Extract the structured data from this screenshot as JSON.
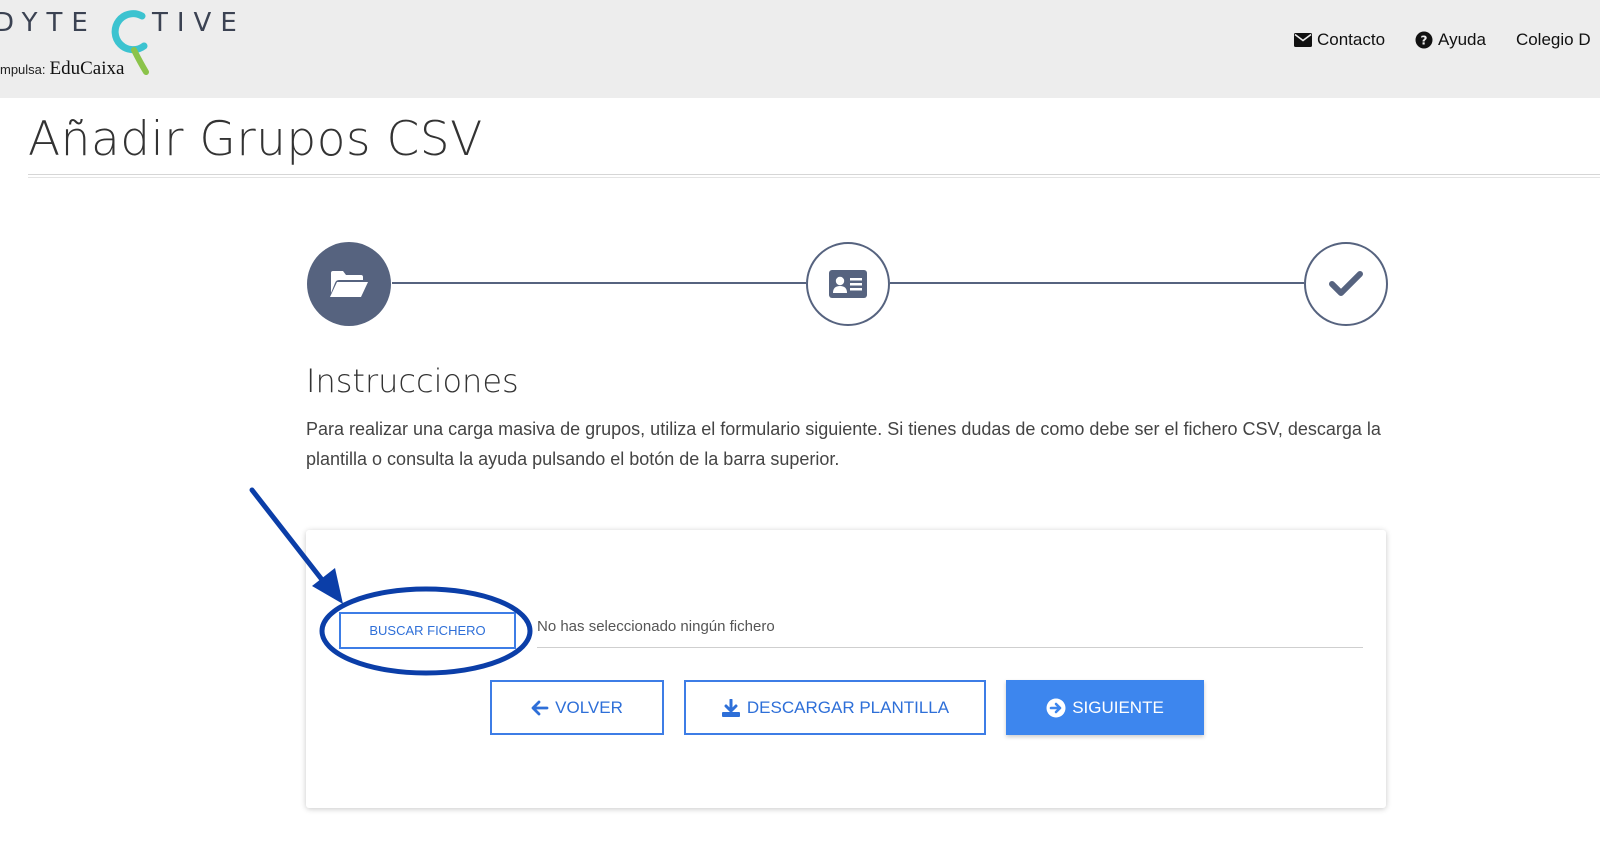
{
  "header": {
    "logo_left": "DYTE",
    "logo_right": "TIVE",
    "logo_sub_prefix": "mpulsa:",
    "logo_sub_brand": "EduCaixa",
    "nav": [
      {
        "label": "Contacto",
        "icon": "envelope-icon"
      },
      {
        "label": "Ayuda",
        "icon": "question-circle-icon"
      },
      {
        "label": "Colegio D"
      }
    ]
  },
  "page": {
    "title": "Añadir Grupos CSV"
  },
  "stepper": {
    "steps": [
      {
        "icon": "folder-open-icon",
        "state": "active"
      },
      {
        "icon": "id-card-icon",
        "state": "pending"
      },
      {
        "icon": "check-icon",
        "state": "pending"
      }
    ],
    "colors": {
      "active": "#56637f",
      "line": "#56637f"
    }
  },
  "instructions": {
    "title": "Instrucciones",
    "text": "Para realizar una carga masiva de grupos, utiliza el formulario siguiente. Si tienes dudas de como debe ser el fichero CSV, descarga la plantilla o consulta la ayuda pulsando el botón de la barra superior."
  },
  "form": {
    "file_button_label": "BUSCAR FICHERO",
    "file_status": "No has seleccionado ningún fichero",
    "back_label": "VOLVER",
    "download_label": "DESCARGAR PLANTILLA",
    "next_label": "SIGUIENTE"
  },
  "colors": {
    "accent": "#3d86ee",
    "annotation": "#0b3ea8",
    "header_bg": "#ededed"
  }
}
